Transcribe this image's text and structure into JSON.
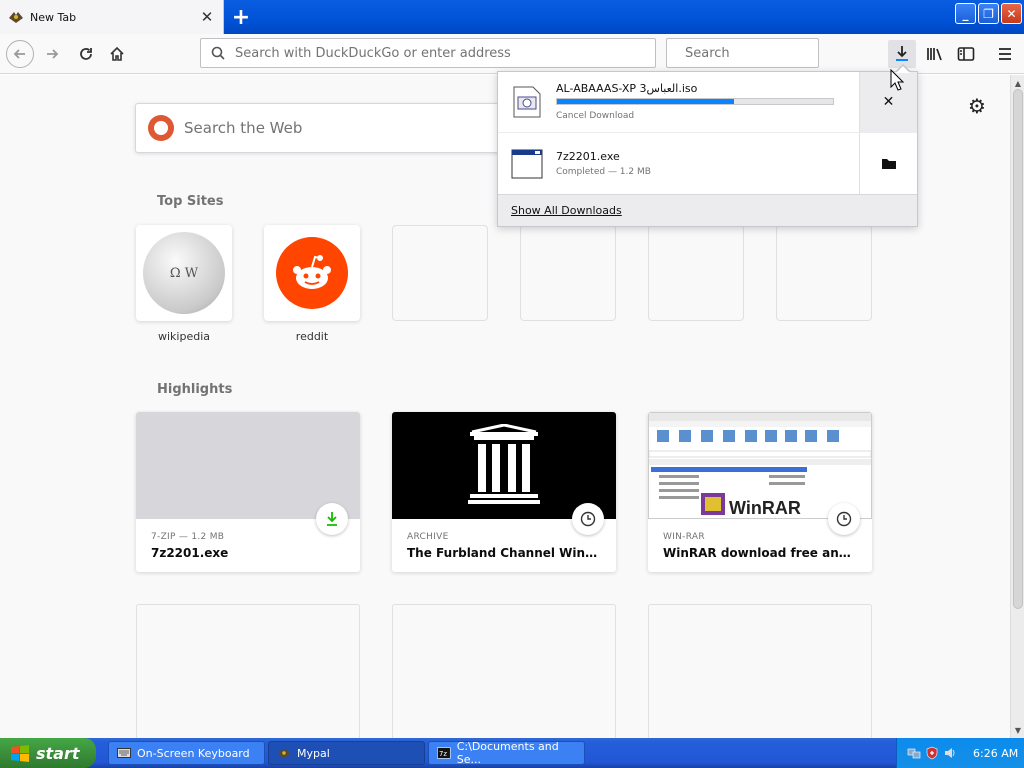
{
  "window": {
    "tab_title": "New Tab",
    "newtab_label": "+",
    "min_label": "_",
    "max_label": "❐",
    "close_label": "✕"
  },
  "navbar": {
    "url_placeholder": "Search with DuckDuckGo or enter address",
    "search_placeholder": "Search"
  },
  "newtab": {
    "web_search_placeholder": "Search the Web",
    "top_sites_title": "Top Sites",
    "top_sites": [
      {
        "label": "wikipedia"
      },
      {
        "label": "reddit"
      }
    ],
    "highlights_title": "Highlights",
    "highlights": [
      {
        "context": "7-ZIP — 1.2 MB",
        "title": "7z2201.exe",
        "badge_icon": "download-icon"
      },
      {
        "context": "ARCHIVE",
        "title": "The Furbland Channel Windows…",
        "badge_icon": "clock-icon"
      },
      {
        "context": "WIN-RAR",
        "title": "WinRAR download free and sup…",
        "badge_icon": "clock-icon"
      }
    ]
  },
  "downloads": {
    "items": [
      {
        "name": "AL-ABAAAS-XP  العباس3.iso",
        "status": "Cancel Download",
        "progress": 0.64,
        "action_icon": "cancel-icon"
      },
      {
        "name": "7z2201.exe",
        "status": "Completed — 1.2 MB",
        "action_icon": "folder-icon"
      }
    ],
    "footer": "Show All Downloads"
  },
  "taskbar": {
    "start_label": "start",
    "items": [
      {
        "label": "On-Screen Keyboard"
      },
      {
        "label": "Mypal"
      },
      {
        "label": "C:\\Documents and Se..."
      }
    ],
    "clock": "6:26 AM"
  },
  "colors": {
    "accent": "#0a84ff",
    "download_badge": "#12bc00",
    "reddit": "#ff4500",
    "ddg": "#de5833"
  }
}
